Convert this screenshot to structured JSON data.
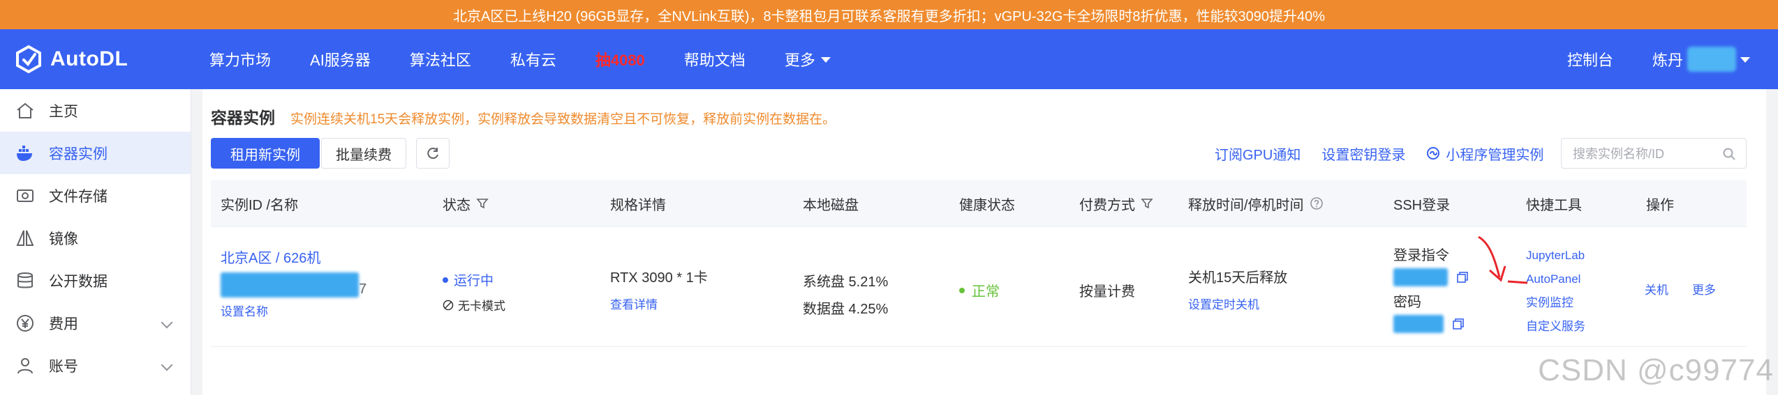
{
  "banner": {
    "text": "北京A区已上线H20 (96GB显存，全NVLink互联)，8卡整租包月可联系客服有更多折扣；vGPU-32G卡全场限时8折优惠，性能较3090提升40%"
  },
  "header": {
    "brand": "AutoDL",
    "nav": [
      "算力市场",
      "AI服务器",
      "算法社区",
      "私有云",
      "抽4080",
      "帮助文档"
    ],
    "more_label": "更多",
    "console_label": "控制台",
    "user_name": "炼丹"
  },
  "sidebar": {
    "items": [
      {
        "label": "主页",
        "icon": "home-icon"
      },
      {
        "label": "容器实例",
        "icon": "container-icon"
      },
      {
        "label": "文件存储",
        "icon": "storage-icon"
      },
      {
        "label": "镜像",
        "icon": "image-icon"
      },
      {
        "label": "公开数据",
        "icon": "database-icon"
      },
      {
        "label": "费用",
        "icon": "yen-icon"
      },
      {
        "label": "账号",
        "icon": "user-icon"
      }
    ]
  },
  "main": {
    "title": "容器实例",
    "notice": "实例连续关机15天会释放实例，实例释放会导致数据清空且不可恢复，释放前实例在数据在。",
    "rent_button": "租用新实例",
    "batch_renew": "批量续费",
    "links": [
      "订阅GPU通知",
      "设置密钥登录",
      "小程序管理实例"
    ],
    "search_placeholder": "搜索实例名称/ID"
  },
  "table": {
    "headers": [
      "实例ID /名称",
      "状态",
      "规格详情",
      "本地磁盘",
      "健康状态",
      "付费方式",
      "释放时间/停机时间",
      "SSH登录",
      "快捷工具",
      "操作"
    ],
    "row": {
      "instance_name": "北京A区 / 626机",
      "instance_id_suffix": "7",
      "set_name": "设置名称",
      "status": "运行中",
      "mode": "无卡模式",
      "spec": "RTX 3090 * 1卡",
      "spec_link": "查看详情",
      "disk_system": "系统盘 5.21%",
      "disk_data": "数据盘 4.25%",
      "health": "正常",
      "billing": "按量计费",
      "release": "关机15天后释放",
      "release_link": "设置定时关机",
      "ssh_login_label": "登录指令",
      "ssh_password_label": "密码",
      "tools": [
        "JupyterLab",
        "AutoPanel",
        "实例监控",
        "自定义服务"
      ],
      "actions": [
        "关机",
        "更多"
      ]
    }
  },
  "watermark": "CSDN @c99774",
  "colors": {
    "brand": "#3762f1",
    "banner": "#ef8b2e",
    "success": "#67c23a",
    "warning": "#ef8b2e",
    "annotation": "#e8262a"
  }
}
